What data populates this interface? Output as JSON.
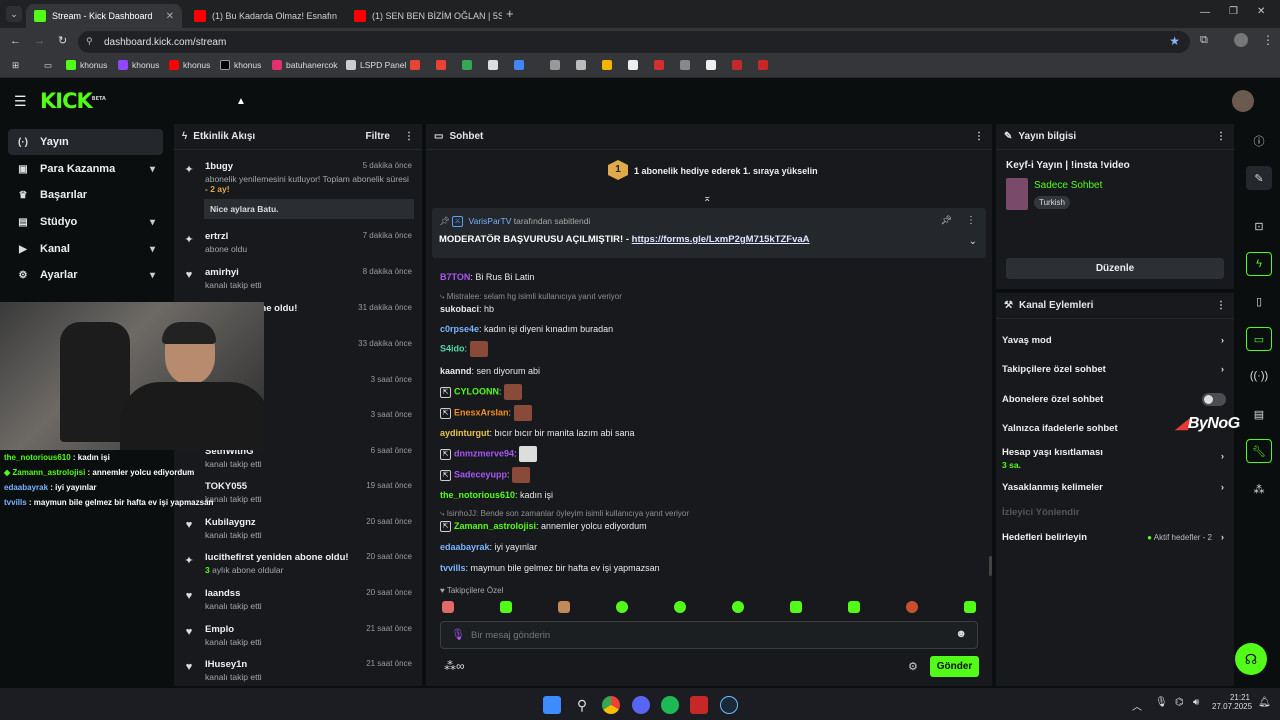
{
  "browser": {
    "tabs": [
      {
        "title": "Stream - Kick Dashboard",
        "color": "#53fc18"
      },
      {
        "title": "(1) Bu Kadarda Olmaz! Esnafın",
        "color": "#ff0000"
      },
      {
        "title": "(1) SEN BEN BİZİM OĞLAN | 5S",
        "color": "#ff0000"
      }
    ],
    "url": "dashboard.kick.com/stream",
    "bookmarks": [
      {
        "label": "khonus",
        "color": "#53fc18"
      },
      {
        "label": "khonus",
        "color": "#9146ff"
      },
      {
        "label": "khonus",
        "color": "#ff0000"
      },
      {
        "label": "khonus",
        "color": "#ffffff"
      },
      {
        "label": "batuhanercok",
        "color": "#e1306c"
      },
      {
        "label": "LSPD Panel",
        "color": "#cccccc"
      }
    ]
  },
  "kick": {
    "logo": "KICK",
    "logo_beta": "BETA"
  },
  "sidebar": {
    "items": [
      {
        "label": "Yayın",
        "icon": "(·)",
        "chev": ""
      },
      {
        "label": "Para Kazanma",
        "icon": "▣",
        "chev": "⌄"
      },
      {
        "label": "Başarılar",
        "icon": "🏆",
        "chev": ""
      },
      {
        "label": "Stüdyo",
        "icon": "▤",
        "chev": "⌄"
      },
      {
        "label": "Kanal",
        "icon": "▶",
        "chev": "⌄"
      },
      {
        "label": "Ayarlar",
        "icon": "⚙",
        "chev": "⌄"
      }
    ]
  },
  "overlay_chat": [
    {
      "user": "the_notorious610",
      "text": " : kadın işi",
      "color": "#53fc18"
    },
    {
      "user": "Zamann_astrolojisi",
      "text": " : annemler yolcu ediyordum",
      "color": "#53fc18"
    },
    {
      "user": "edaabayrak",
      "text": " : iyi yayınlar",
      "color": "#7ab4ff"
    },
    {
      "user": "tvvills",
      "text": " : maymun bile gelmez bir hafta ev işi yapmazsan",
      "color": "#7ab4ff"
    }
  ],
  "events": {
    "title": "Etkinlik Akışı",
    "filter": "Filtre",
    "items": [
      {
        "name": "1bugy",
        "sub": "abonelik yenilemesini kutluyor! Toplam abonelik süresi",
        "sub2": "- 2 ay!",
        "time": "5 dakika önce",
        "note": "Nice aylara Batu."
      },
      {
        "name": "ertrzl",
        "sub": "abone oldu",
        "time": "7 dakika önce"
      },
      {
        "name": "amirhyi",
        "sub": "kanalı takip etti",
        "time": "8 dakika önce"
      },
      {
        "name": "yeniden abone oldu!",
        "sub": "oldular",
        "time": "31 dakika önce"
      },
      {
        "name": "",
        "sub": "",
        "time": "33 dakika önce"
      },
      {
        "name": "",
        "sub": "",
        "time": "3 saat önce"
      },
      {
        "name": "",
        "sub": "",
        "time": "3 saat önce"
      },
      {
        "name": "SethWithG",
        "sub": "kanalı takip etti",
        "time": "6 saat önce"
      },
      {
        "name": "TOKY055",
        "sub": "kanalı takip etti",
        "time": "19 saat önce"
      },
      {
        "name": "Kubilaygnz",
        "sub": "kanalı takip etti",
        "time": "20 saat önce"
      },
      {
        "name": "lucithefirst yeniden abone oldu!",
        "sub": "3 aylık abone oldular",
        "time": "20 saat önce"
      },
      {
        "name": "laandss",
        "sub": "kanalı takip etti",
        "time": "20 saat önce"
      },
      {
        "name": "Emplo",
        "sub": "kanalı takip etti",
        "time": "21 saat önce"
      },
      {
        "name": "IHusey1n",
        "sub": "kanalı takip etti",
        "time": "21 saat önce"
      }
    ]
  },
  "chat": {
    "title": "Sohbet",
    "gift_banner": "1 abonelik hediye ederek 1. sıraya yükselin",
    "gift_rank": "1",
    "pinned_by_user": "VarisParTV",
    "pinned_by_text": "tarafından sabitlendi",
    "pinned_message": "MODERATÖR BAŞVURUSU AÇILMIŞTIR! - ",
    "pinned_link": "https://forms.gle/LxmP2gM715kTZFvaA",
    "messages": [
      {
        "user": "B7TON",
        "text": ": Bi Rus Bi Latin",
        "color": "#a855f7"
      },
      {
        "user": "sukobaci",
        "text": ": hb",
        "color": "#e8e8e8"
      },
      {
        "user": "c0rpse4e",
        "text": ": kadın işi diyeni kınadım buradan",
        "color": "#7ab4ff"
      },
      {
        "user": "S4ido",
        "text": ":",
        "color": "#53d8a8"
      },
      {
        "user": "kaannd",
        "text": ": sen diyorum abi",
        "color": "#e8e8e8"
      },
      {
        "user": "CYLOONN",
        "text": ":",
        "color": "#53fc18"
      },
      {
        "user": "EnesxArslan",
        "text": ":",
        "color": "#f28c28"
      },
      {
        "user": "aydinturgut",
        "text": ": bıcır bıcır bir manita lazım abi sana",
        "color": "#e8c547"
      },
      {
        "user": "dnmzmerve94",
        "text": ":",
        "color": "#a855f7"
      },
      {
        "user": "Sadeceyupp",
        "text": ":",
        "color": "#a855f7"
      },
      {
        "user": "the_notorious610",
        "text": ": kadın işi",
        "color": "#53fc18"
      },
      {
        "user": "Zamann_astrolojisi",
        "text": ": annemler yolcu ediyordum",
        "color": "#53fc18"
      },
      {
        "user": "edaabayrak",
        "text": ": iyi yayınlar",
        "color": "#7ab4ff"
      },
      {
        "user": "tvvills",
        "text": ": maymun bile gelmez bir hafta ev işi yapmazsan",
        "color": "#7ab4ff"
      }
    ],
    "replies": [
      "Mistralee: selam hg isimli kullanıcıya yanıt veriyor",
      "IsinhoJJ: Bende son zamanlar öyleyim isimli kullanıcıya yanıt veriyor"
    ],
    "followers_only_label": "Takipçilere Özel",
    "input_placeholder": "Bir mesaj gönderin",
    "send_label": "Gönder"
  },
  "stream_info": {
    "title": "Yayın bilgisi",
    "stream_title": "Keyf-i Yayın | !insta !video",
    "category": "Sadece Sohbet",
    "language": "Turkish",
    "edit_label": "Düzenle"
  },
  "channel_actions": {
    "title": "Kanal Eylemleri",
    "rows": [
      {
        "label": "Yavaş mod"
      },
      {
        "label": "Takipçilere özel sohbet"
      },
      {
        "label": "Abonelere özel sohbet"
      },
      {
        "label": "Yalnızca ifadelerle sohbet"
      },
      {
        "label": "Hesap yaşı kısıtlaması",
        "sub": "3 sa."
      },
      {
        "label": "Yasaklanmış kelimeler"
      },
      {
        "label": "İzleyici Yönlendir"
      },
      {
        "label": "Hedefleri belirleyin",
        "right": "Aktif hedefler - 2"
      }
    ]
  },
  "watermark": "ByNoGame",
  "taskbar": {
    "time": "21:21",
    "date": "27.07.2025"
  }
}
